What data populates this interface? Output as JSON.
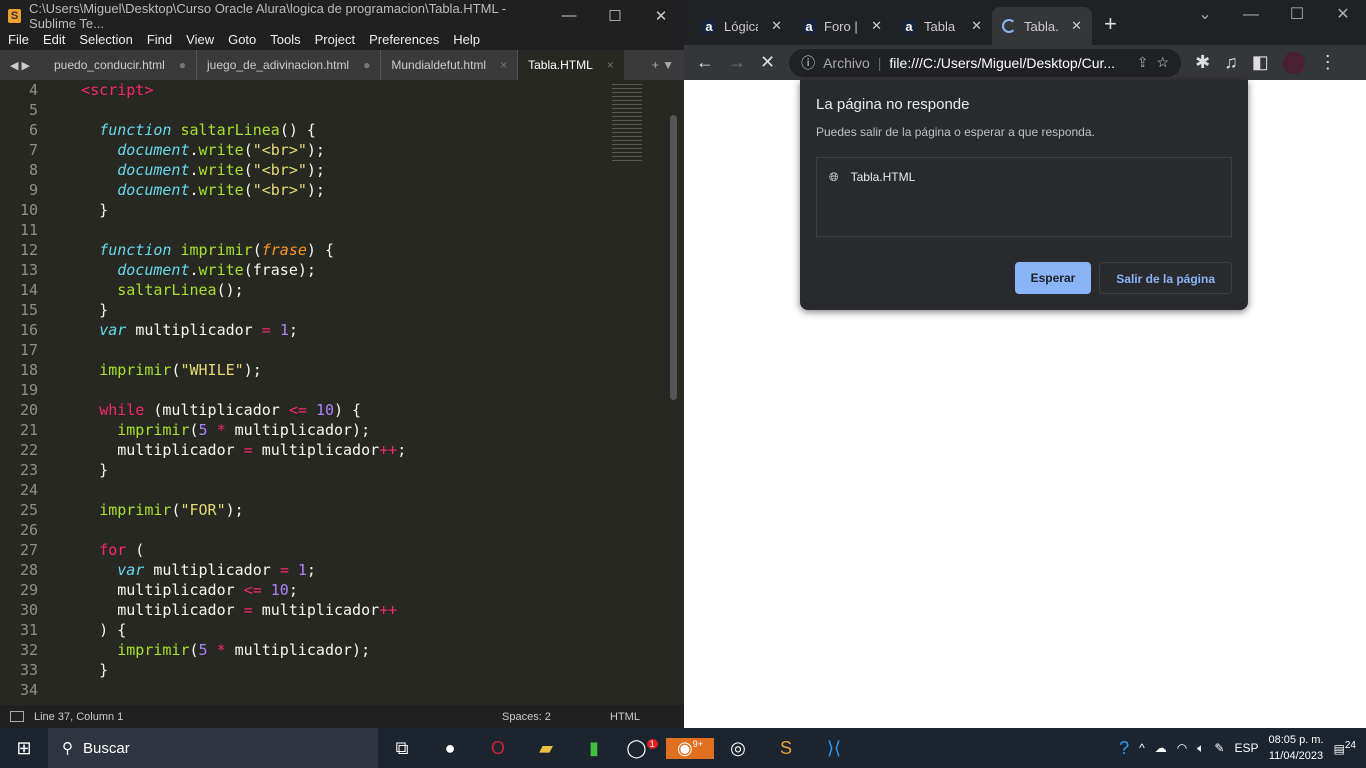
{
  "sublime": {
    "title": "C:\\Users\\Miguel\\Desktop\\Curso Oracle Alura\\logica de programacion\\Tabla.HTML - Sublime Te...",
    "menu": [
      "File",
      "Edit",
      "Selection",
      "Find",
      "View",
      "Goto",
      "Tools",
      "Project",
      "Preferences",
      "Help"
    ],
    "tabs": [
      {
        "label": "puedo_conducir.html",
        "mark": "●"
      },
      {
        "label": "juego_de_adivinacion.html",
        "mark": "●"
      },
      {
        "label": "Mundialdefut.html",
        "mark": "×"
      },
      {
        "label": "Tabla.HTML",
        "mark": "×",
        "active": true
      }
    ],
    "code": [
      [
        4,
        [
          [
            "t",
            "    "
          ],
          [
            "tag",
            "<script>"
          ]
        ]
      ],
      [
        5,
        []
      ],
      [
        6,
        [
          [
            "t",
            "      "
          ],
          [
            "k",
            "function "
          ],
          [
            "f",
            "saltarLinea"
          ],
          [
            "t",
            "() {"
          ]
        ]
      ],
      [
        7,
        [
          [
            "t",
            "        "
          ],
          [
            "k",
            "document"
          ],
          [
            "t",
            "."
          ],
          [
            "f",
            "write"
          ],
          [
            "t",
            "("
          ],
          [
            "s",
            "\"<br>\""
          ],
          [
            "t",
            ");"
          ]
        ]
      ],
      [
        8,
        [
          [
            "t",
            "        "
          ],
          [
            "k",
            "document"
          ],
          [
            "t",
            "."
          ],
          [
            "f",
            "write"
          ],
          [
            "t",
            "("
          ],
          [
            "s",
            "\"<br>\""
          ],
          [
            "t",
            ");"
          ]
        ]
      ],
      [
        9,
        [
          [
            "t",
            "        "
          ],
          [
            "k",
            "document"
          ],
          [
            "t",
            "."
          ],
          [
            "f",
            "write"
          ],
          [
            "t",
            "("
          ],
          [
            "s",
            "\"<br>\""
          ],
          [
            "t",
            ");"
          ]
        ]
      ],
      [
        10,
        [
          [
            "t",
            "      }"
          ]
        ]
      ],
      [
        11,
        []
      ],
      [
        12,
        [
          [
            "t",
            "      "
          ],
          [
            "k",
            "function "
          ],
          [
            "f",
            "imprimir"
          ],
          [
            "t",
            "("
          ],
          [
            "p",
            "frase"
          ],
          [
            "t",
            ") {"
          ]
        ]
      ],
      [
        13,
        [
          [
            "t",
            "        "
          ],
          [
            "k",
            "document"
          ],
          [
            "t",
            "."
          ],
          [
            "f",
            "write"
          ],
          [
            "t",
            "(frase);"
          ]
        ]
      ],
      [
        14,
        [
          [
            "t",
            "        "
          ],
          [
            "f",
            "saltarLinea"
          ],
          [
            "t",
            "();"
          ]
        ]
      ],
      [
        15,
        [
          [
            "t",
            "      }"
          ]
        ]
      ],
      [
        16,
        [
          [
            "t",
            "      "
          ],
          [
            "k",
            "var "
          ],
          [
            "t",
            "multiplicador "
          ],
          [
            "o",
            "="
          ],
          [
            "t",
            " "
          ],
          [
            "n",
            "1"
          ],
          [
            "t",
            ";"
          ]
        ]
      ],
      [
        17,
        []
      ],
      [
        18,
        [
          [
            "t",
            "      "
          ],
          [
            "f",
            "imprimir"
          ],
          [
            "t",
            "("
          ],
          [
            "s",
            "\"WHILE\""
          ],
          [
            "t",
            ");"
          ]
        ]
      ],
      [
        19,
        []
      ],
      [
        20,
        [
          [
            "t",
            "      "
          ],
          [
            "kp",
            "while"
          ],
          [
            "t",
            " (multiplicador "
          ],
          [
            "o",
            "<="
          ],
          [
            "t",
            " "
          ],
          [
            "n",
            "10"
          ],
          [
            "t",
            ") {"
          ]
        ]
      ],
      [
        21,
        [
          [
            "t",
            "        "
          ],
          [
            "f",
            "imprimir"
          ],
          [
            "t",
            "("
          ],
          [
            "n",
            "5"
          ],
          [
            "t",
            " "
          ],
          [
            "o",
            "*"
          ],
          [
            "t",
            " multiplicador);"
          ]
        ]
      ],
      [
        22,
        [
          [
            "t",
            "        multiplicador "
          ],
          [
            "o",
            "="
          ],
          [
            "t",
            " multiplicador"
          ],
          [
            "o",
            "++"
          ],
          [
            "t",
            ";"
          ]
        ]
      ],
      [
        23,
        [
          [
            "t",
            "      }"
          ]
        ]
      ],
      [
        24,
        []
      ],
      [
        25,
        [
          [
            "t",
            "      "
          ],
          [
            "f",
            "imprimir"
          ],
          [
            "t",
            "("
          ],
          [
            "s",
            "\"FOR\""
          ],
          [
            "t",
            ");"
          ]
        ]
      ],
      [
        26,
        []
      ],
      [
        27,
        [
          [
            "t",
            "      "
          ],
          [
            "kp",
            "for"
          ],
          [
            "t",
            " ("
          ]
        ]
      ],
      [
        28,
        [
          [
            "t",
            "        "
          ],
          [
            "k",
            "var "
          ],
          [
            "t",
            "multiplicador "
          ],
          [
            "o",
            "="
          ],
          [
            "t",
            " "
          ],
          [
            "n",
            "1"
          ],
          [
            "t",
            ";"
          ]
        ]
      ],
      [
        29,
        [
          [
            "t",
            "        multiplicador "
          ],
          [
            "o",
            "<="
          ],
          [
            "t",
            " "
          ],
          [
            "n",
            "10"
          ],
          [
            "t",
            ";"
          ]
        ]
      ],
      [
        30,
        [
          [
            "t",
            "        multiplicador "
          ],
          [
            "o",
            "="
          ],
          [
            "t",
            " multiplicador"
          ],
          [
            "o",
            "++"
          ]
        ]
      ],
      [
        31,
        [
          [
            "t",
            "      ) {"
          ]
        ]
      ],
      [
        32,
        [
          [
            "t",
            "        "
          ],
          [
            "f",
            "imprimir"
          ],
          [
            "t",
            "("
          ],
          [
            "n",
            "5"
          ],
          [
            "t",
            " "
          ],
          [
            "o",
            "*"
          ],
          [
            "t",
            " multiplicador);"
          ]
        ]
      ],
      [
        33,
        [
          [
            "t",
            "      }"
          ]
        ]
      ],
      [
        34,
        []
      ]
    ],
    "status": {
      "position": "Line 37, Column 1",
      "spaces": "Spaces: 2",
      "syntax": "HTML"
    }
  },
  "chrome": {
    "tabs": [
      {
        "label": "Lógica",
        "icon": "a"
      },
      {
        "label": "Foro | A",
        "icon": "a"
      },
      {
        "label": "Tabla d",
        "icon": "a"
      },
      {
        "label": "Tabla.H",
        "icon": "spinner",
        "active": true
      }
    ],
    "address_prefix": "Archivo",
    "url": "file:///C:/Users/Miguel/Desktop/Cur...",
    "dialog": {
      "title": "La página no responde",
      "subtitle": "Puedes salir de la página o esperar a que responda.",
      "page": "Tabla.HTML",
      "wait": "Esperar",
      "leave": "Salir de la página",
      "accent": "#8ab4f8"
    }
  },
  "taskbar": {
    "search": "Buscar",
    "lang": "ESP",
    "time": "08:05 p. m.",
    "date": "11/04/2023",
    "notifications": "24",
    "whatsapp_badge": "1",
    "discord_badge": "9+"
  }
}
